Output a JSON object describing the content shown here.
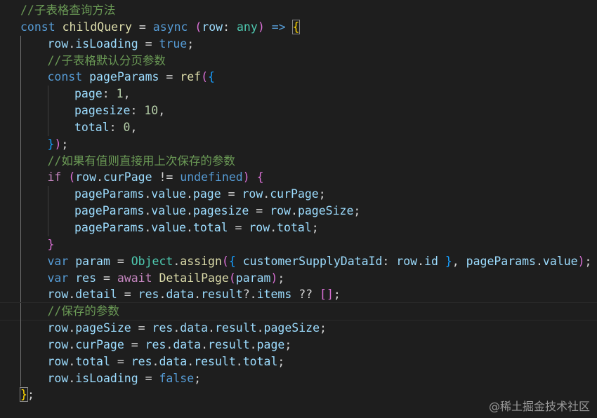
{
  "colors": {
    "background": "#1e1e1e",
    "keyword": "#569cd6",
    "control": "#c586c0",
    "function": "#dcdcaa",
    "variable": "#9cdcfe",
    "number": "#b5cea8",
    "comment": "#6a9955",
    "type": "#4ec9b0",
    "bracket_1": "#ffd700",
    "bracket_2": "#da70d6",
    "bracket_3": "#179fff"
  },
  "code": {
    "lines": [
      {
        "indent": 0,
        "tokens": [
          [
            "cmt",
            "//子表格查询方法"
          ]
        ]
      },
      {
        "indent": 0,
        "tokens": [
          [
            "kw",
            "const"
          ],
          [
            "plain",
            " "
          ],
          [
            "fn",
            "childQuery"
          ],
          [
            "plain",
            " = "
          ],
          [
            "kw",
            "async"
          ],
          [
            "plain",
            " "
          ],
          [
            "br2",
            "("
          ],
          [
            "var",
            "row"
          ],
          [
            "plain",
            ": "
          ],
          [
            "type",
            "any"
          ],
          [
            "br2",
            ")"
          ],
          [
            "plain",
            " "
          ],
          [
            "arrow",
            "=>"
          ],
          [
            "plain",
            " "
          ],
          [
            "br1 bm",
            "{"
          ]
        ]
      },
      {
        "indent": 1,
        "tokens": [
          [
            "var",
            "row"
          ],
          [
            "plain",
            "."
          ],
          [
            "var",
            "isLoading"
          ],
          [
            "plain",
            " = "
          ],
          [
            "kw",
            "true"
          ],
          [
            "plain",
            ";"
          ]
        ]
      },
      {
        "indent": 1,
        "tokens": [
          [
            "cmt",
            "//子表格默认分页参数"
          ]
        ]
      },
      {
        "indent": 1,
        "tokens": [
          [
            "kw",
            "const"
          ],
          [
            "plain",
            " "
          ],
          [
            "var",
            "pageParams"
          ],
          [
            "plain",
            " = "
          ],
          [
            "fn",
            "ref"
          ],
          [
            "br2",
            "("
          ],
          [
            "br3",
            "{"
          ]
        ]
      },
      {
        "indent": 2,
        "tokens": [
          [
            "var",
            "page"
          ],
          [
            "plain",
            ": "
          ],
          [
            "num",
            "1"
          ],
          [
            "plain",
            ","
          ]
        ]
      },
      {
        "indent": 2,
        "tokens": [
          [
            "var",
            "pagesize"
          ],
          [
            "plain",
            ": "
          ],
          [
            "num",
            "10"
          ],
          [
            "plain",
            ","
          ]
        ]
      },
      {
        "indent": 2,
        "tokens": [
          [
            "var",
            "total"
          ],
          [
            "plain",
            ": "
          ],
          [
            "num",
            "0"
          ],
          [
            "plain",
            ","
          ]
        ]
      },
      {
        "indent": 1,
        "tokens": [
          [
            "br3",
            "}"
          ],
          [
            "br2",
            ")"
          ],
          [
            "plain",
            ";"
          ]
        ]
      },
      {
        "indent": 1,
        "tokens": [
          [
            "cmt",
            "//如果有值则直接用上次保存的参数"
          ]
        ]
      },
      {
        "indent": 1,
        "tokens": [
          [
            "ctl",
            "if"
          ],
          [
            "plain",
            " "
          ],
          [
            "br2",
            "("
          ],
          [
            "var",
            "row"
          ],
          [
            "plain",
            "."
          ],
          [
            "var",
            "curPage"
          ],
          [
            "plain",
            " != "
          ],
          [
            "kw",
            "undefined"
          ],
          [
            "br2",
            ")"
          ],
          [
            "plain",
            " "
          ],
          [
            "br2",
            "{"
          ]
        ]
      },
      {
        "indent": 2,
        "tokens": [
          [
            "var",
            "pageParams"
          ],
          [
            "plain",
            "."
          ],
          [
            "var",
            "value"
          ],
          [
            "plain",
            "."
          ],
          [
            "var",
            "page"
          ],
          [
            "plain",
            " = "
          ],
          [
            "var",
            "row"
          ],
          [
            "plain",
            "."
          ],
          [
            "var",
            "curPage"
          ],
          [
            "plain",
            ";"
          ]
        ]
      },
      {
        "indent": 2,
        "tokens": [
          [
            "var",
            "pageParams"
          ],
          [
            "plain",
            "."
          ],
          [
            "var",
            "value"
          ],
          [
            "plain",
            "."
          ],
          [
            "var",
            "pagesize"
          ],
          [
            "plain",
            " = "
          ],
          [
            "var",
            "row"
          ],
          [
            "plain",
            "."
          ],
          [
            "var",
            "pageSize"
          ],
          [
            "plain",
            ";"
          ]
        ]
      },
      {
        "indent": 2,
        "tokens": [
          [
            "var",
            "pageParams"
          ],
          [
            "plain",
            "."
          ],
          [
            "var",
            "value"
          ],
          [
            "plain",
            "."
          ],
          [
            "var",
            "total"
          ],
          [
            "plain",
            " = "
          ],
          [
            "var",
            "row"
          ],
          [
            "plain",
            "."
          ],
          [
            "var",
            "total"
          ],
          [
            "plain",
            ";"
          ]
        ]
      },
      {
        "indent": 1,
        "tokens": [
          [
            "br2",
            "}"
          ]
        ]
      },
      {
        "indent": 1,
        "tokens": [
          [
            "kw",
            "var"
          ],
          [
            "plain",
            " "
          ],
          [
            "var",
            "param"
          ],
          [
            "plain",
            " = "
          ],
          [
            "type",
            "Object"
          ],
          [
            "plain",
            "."
          ],
          [
            "fn",
            "assign"
          ],
          [
            "br2",
            "("
          ],
          [
            "br3",
            "{"
          ],
          [
            "plain",
            " "
          ],
          [
            "var",
            "customerSupplyDataId"
          ],
          [
            "plain",
            ": "
          ],
          [
            "var",
            "row"
          ],
          [
            "plain",
            "."
          ],
          [
            "var",
            "id"
          ],
          [
            "plain",
            " "
          ],
          [
            "br3",
            "}"
          ],
          [
            "plain",
            ", "
          ],
          [
            "var",
            "pageParams"
          ],
          [
            "plain",
            "."
          ],
          [
            "var",
            "value"
          ],
          [
            "br2",
            ")"
          ],
          [
            "plain",
            ";"
          ]
        ]
      },
      {
        "indent": 1,
        "tokens": [
          [
            "kw",
            "var"
          ],
          [
            "plain",
            " "
          ],
          [
            "var",
            "res"
          ],
          [
            "plain",
            " = "
          ],
          [
            "ctl",
            "await"
          ],
          [
            "plain",
            " "
          ],
          [
            "fn",
            "DetailPage"
          ],
          [
            "br2",
            "("
          ],
          [
            "var",
            "param"
          ],
          [
            "br2",
            ")"
          ],
          [
            "plain",
            ";"
          ]
        ]
      },
      {
        "indent": 1,
        "tokens": [
          [
            "var",
            "row"
          ],
          [
            "plain",
            "."
          ],
          [
            "var",
            "detail"
          ],
          [
            "plain",
            " = "
          ],
          [
            "var",
            "res"
          ],
          [
            "plain",
            "."
          ],
          [
            "var",
            "data"
          ],
          [
            "plain",
            "."
          ],
          [
            "var",
            "result"
          ],
          [
            "plain",
            "?."
          ],
          [
            "var",
            "items"
          ],
          [
            "plain",
            " ?? "
          ],
          [
            "br2",
            "[]"
          ],
          [
            "plain",
            ";"
          ]
        ]
      },
      {
        "indent": 1,
        "current": true,
        "tokens": [
          [
            "cmt",
            "//保存的参数"
          ]
        ]
      },
      {
        "indent": 1,
        "tokens": [
          [
            "var",
            "row"
          ],
          [
            "plain",
            "."
          ],
          [
            "var",
            "pageSize"
          ],
          [
            "plain",
            " = "
          ],
          [
            "var",
            "res"
          ],
          [
            "plain",
            "."
          ],
          [
            "var",
            "data"
          ],
          [
            "plain",
            "."
          ],
          [
            "var",
            "result"
          ],
          [
            "plain",
            "."
          ],
          [
            "var",
            "pageSize"
          ],
          [
            "plain",
            ";"
          ]
        ]
      },
      {
        "indent": 1,
        "tokens": [
          [
            "var",
            "row"
          ],
          [
            "plain",
            "."
          ],
          [
            "var",
            "curPage"
          ],
          [
            "plain",
            " = "
          ],
          [
            "var",
            "res"
          ],
          [
            "plain",
            "."
          ],
          [
            "var",
            "data"
          ],
          [
            "plain",
            "."
          ],
          [
            "var",
            "result"
          ],
          [
            "plain",
            "."
          ],
          [
            "var",
            "page"
          ],
          [
            "plain",
            ";"
          ]
        ]
      },
      {
        "indent": 1,
        "tokens": [
          [
            "var",
            "row"
          ],
          [
            "plain",
            "."
          ],
          [
            "var",
            "total"
          ],
          [
            "plain",
            " = "
          ],
          [
            "var",
            "res"
          ],
          [
            "plain",
            "."
          ],
          [
            "var",
            "data"
          ],
          [
            "plain",
            "."
          ],
          [
            "var",
            "result"
          ],
          [
            "plain",
            "."
          ],
          [
            "var",
            "total"
          ],
          [
            "plain",
            ";"
          ]
        ]
      },
      {
        "indent": 1,
        "tokens": [
          [
            "var",
            "row"
          ],
          [
            "plain",
            "."
          ],
          [
            "var",
            "isLoading"
          ],
          [
            "plain",
            " = "
          ],
          [
            "kw",
            "false"
          ],
          [
            "plain",
            ";"
          ]
        ]
      },
      {
        "indent": 0,
        "tokens": [
          [
            "br1 bm",
            "}"
          ],
          [
            "plain",
            ";"
          ]
        ]
      }
    ]
  },
  "watermark": "@稀土掘金技术社区"
}
